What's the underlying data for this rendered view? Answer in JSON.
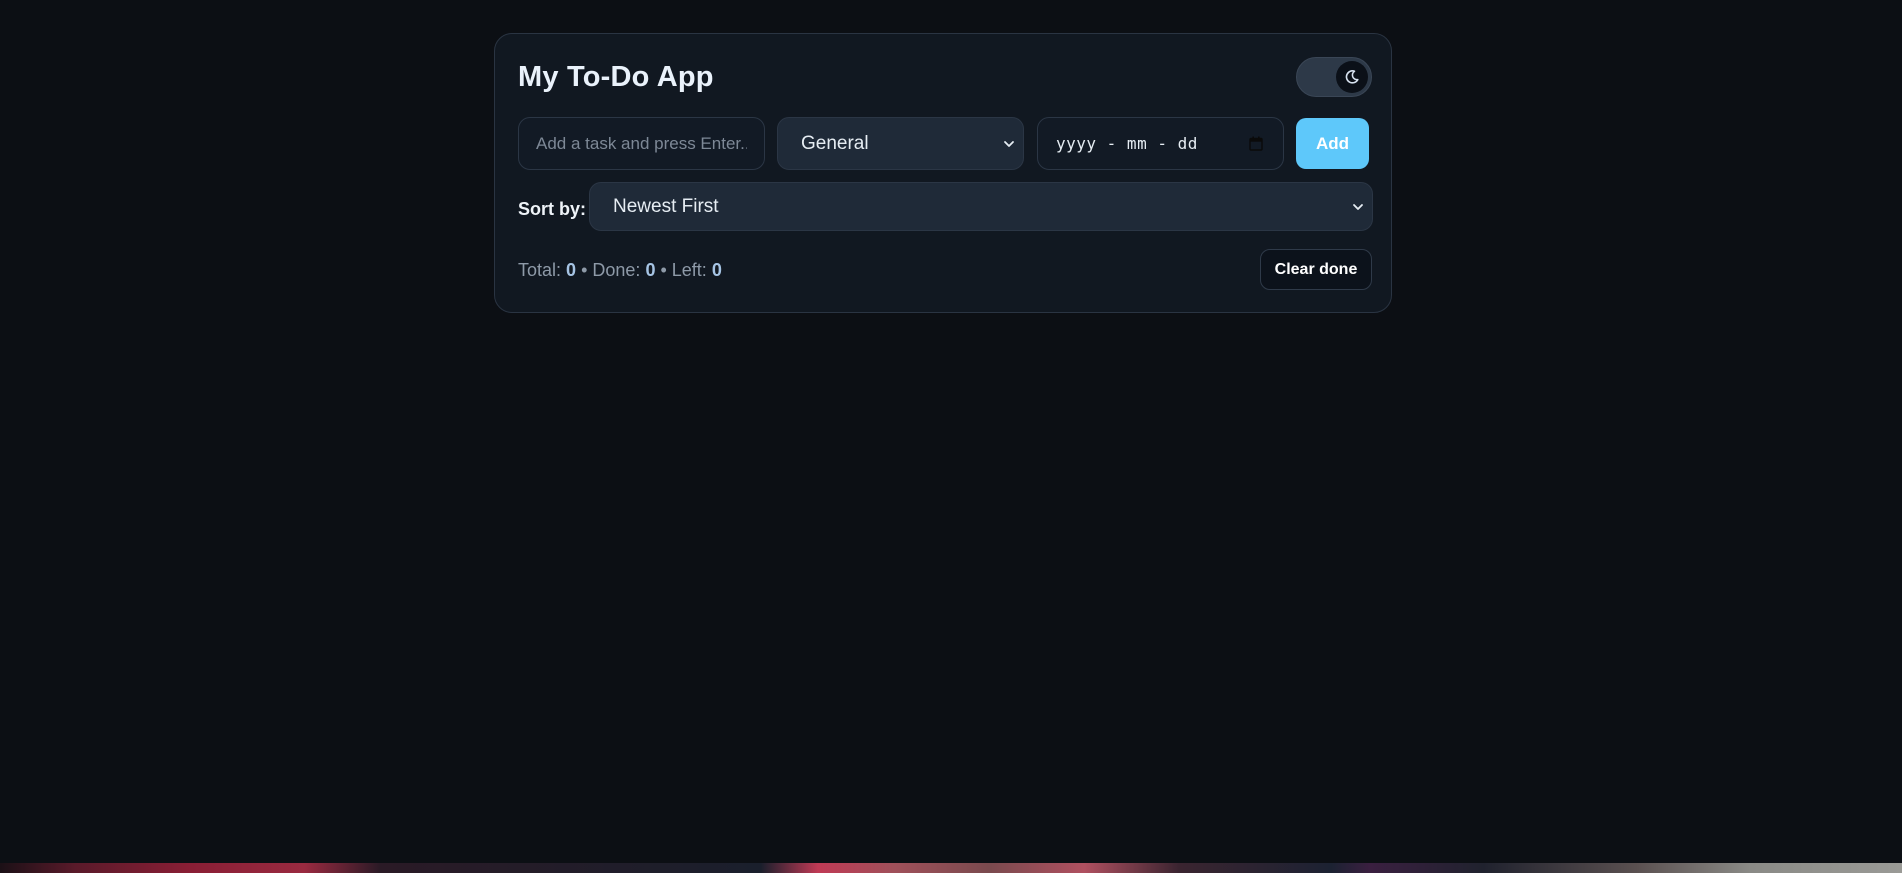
{
  "app": {
    "title": "My To-Do App"
  },
  "theme_toggle": {
    "icon": "moon-icon",
    "state": "dark"
  },
  "new_task": {
    "input_placeholder": "Add a task and press Enter...",
    "input_value": "",
    "category_selected": "General",
    "date_value": "yyyy - mm - dd",
    "add_label": "Add"
  },
  "sort": {
    "label": "Sort by:",
    "selected": "Newest First"
  },
  "stats": {
    "total_label": "Total:",
    "total": "0",
    "sep1": " • ",
    "done_label": "Done:",
    "done": "0",
    "sep2": " • ",
    "left_label": "Left:",
    "left": "0"
  },
  "clear_done_label": "Clear done",
  "colors": {
    "background": "#0c0f14",
    "card": "#111821",
    "accent": "#5ec8fa"
  }
}
